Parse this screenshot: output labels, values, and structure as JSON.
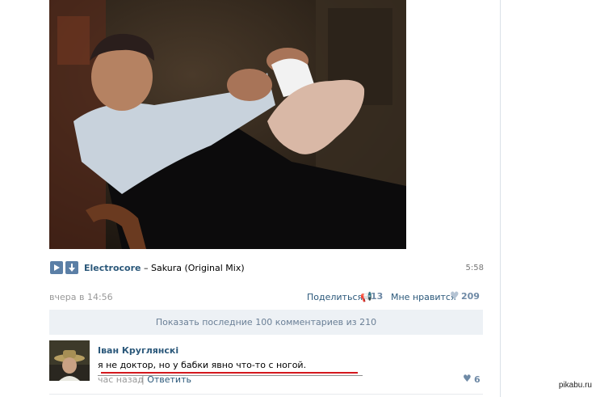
{
  "post": {
    "audio": {
      "artist": "Electrocore",
      "separator": " – ",
      "track": "Sakura (Original Mix)",
      "duration": "5:58"
    },
    "date": "вчера в 14:56",
    "share_label": "Поделиться",
    "share_count": "13",
    "like_label": "Мне нравится",
    "like_count": "209",
    "icons": {
      "play": "play-icon",
      "add": "add-down-arrow-icon",
      "share": "megaphone-icon",
      "like": "heart-icon"
    }
  },
  "comments": {
    "show_all_label": "Показать последние 100 комментариев из 210",
    "items": [
      {
        "author": "Іван Круглянскі",
        "text": "я не доктор, но у бабки явно что-то с ногой.",
        "time": "час назад",
        "separator": " | ",
        "reply_label": "Ответить",
        "likes": "6"
      }
    ]
  },
  "watermark": "pikabu.ru",
  "colors": {
    "link": "#2b587a",
    "muted": "#999999",
    "bar_bg": "#edf1f5",
    "highlight_underline": "#d4181e",
    "audio_button": "#5b7fa6"
  }
}
